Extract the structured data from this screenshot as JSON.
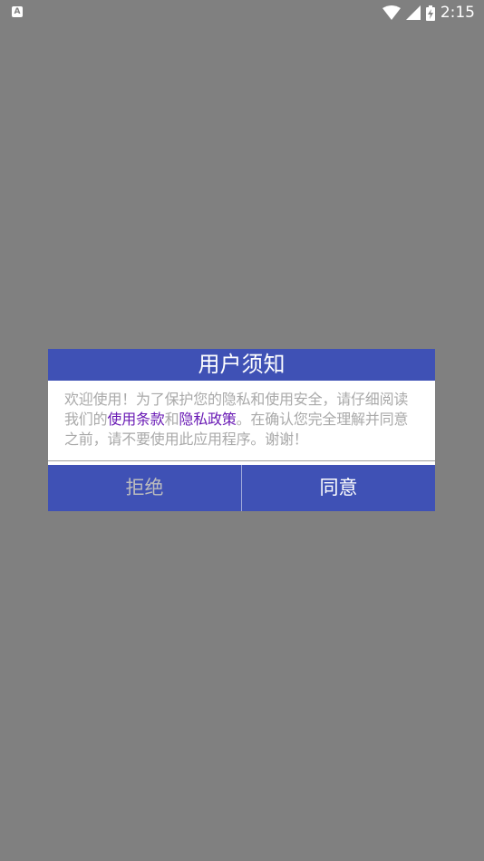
{
  "status_bar": {
    "notification_icon_letter": "A",
    "time": "2:15"
  },
  "dialog": {
    "title": "用户须知",
    "body_prefix": "欢迎使用！为了保护您的隐私和使用安全，请仔细阅读我们的",
    "terms_link": "使用条款",
    "conjunction": "和",
    "privacy_link": "隐私政策",
    "body_suffix": "。在确认您完全理解并同意之前，请不要使用此应用程序。谢谢！",
    "reject_label": "拒绝",
    "agree_label": "同意"
  },
  "colors": {
    "scrim": "#808080",
    "primary": "#3f51b5",
    "link": "#6a1bb5",
    "body_text": "#a9a9a9"
  }
}
